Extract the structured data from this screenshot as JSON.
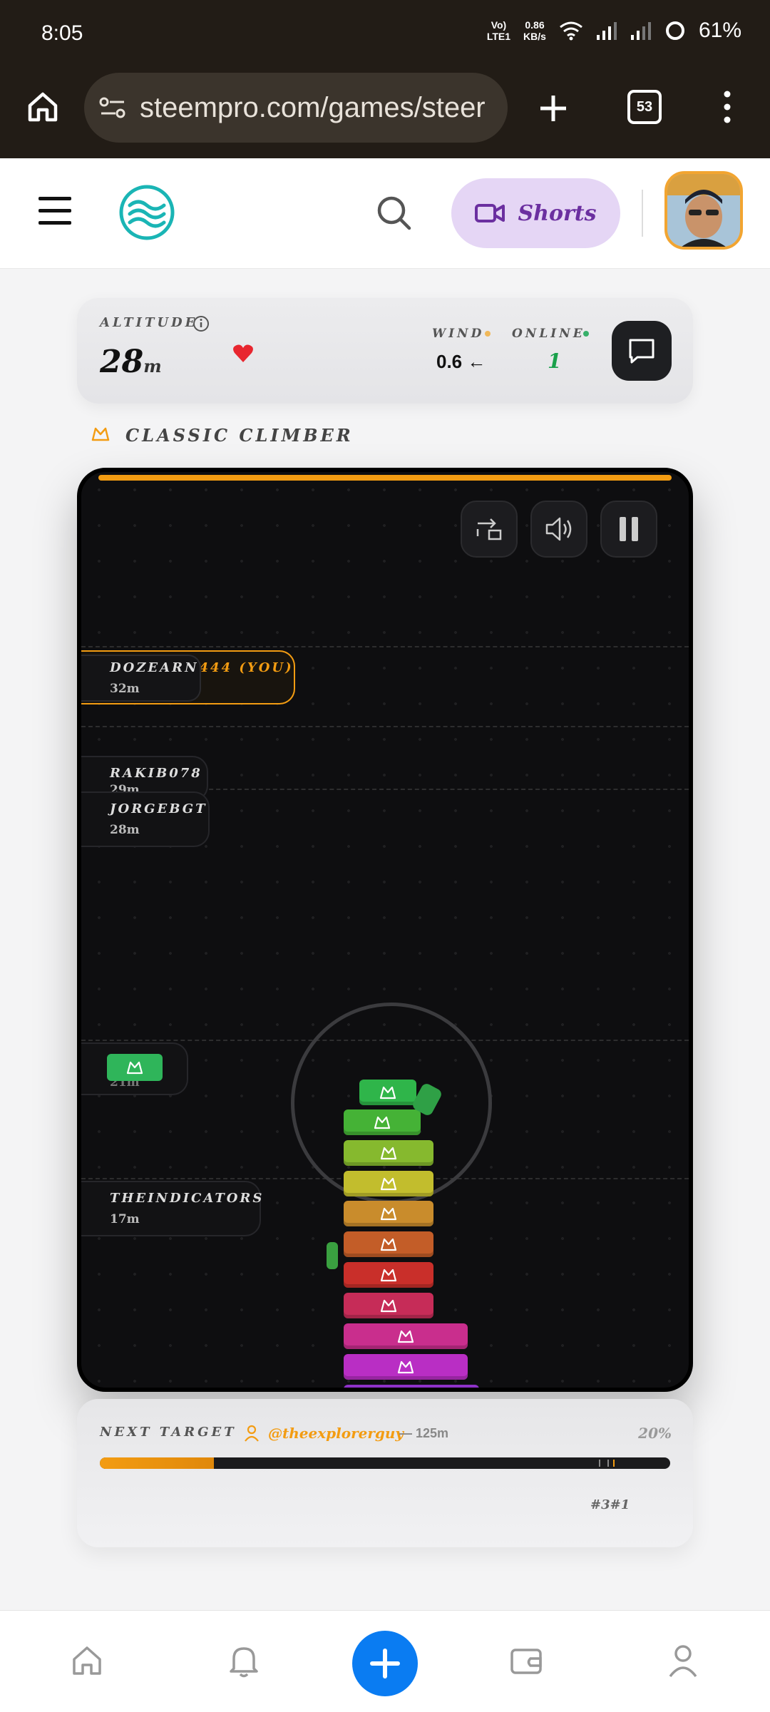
{
  "status": {
    "time": "8:05",
    "network_top": "Vo)",
    "network_bottom": "LTE1",
    "speed_top": "0.86",
    "speed_bottom": "KB/s",
    "battery": "61%"
  },
  "browser": {
    "url": "steempro.com/games/steer",
    "tab_count": "53"
  },
  "header": {
    "shorts_label": "Shorts"
  },
  "stats": {
    "altitude_label": "ALTITUDE",
    "altitude_value": "28",
    "altitude_unit": "m",
    "wind_label": "WIND",
    "wind_value": "0.6 ←",
    "online_label": "ONLINE",
    "online_value": "1"
  },
  "mode": {
    "label": "CLASSIC CLIMBER"
  },
  "game": {
    "players": [
      {
        "name": "DOZEARN",
        "name_hidden_part": "1444 (YOU)",
        "height": "32m"
      },
      {
        "name": "RAKIB078",
        "height": "29m"
      },
      {
        "name": "JORGEBGT",
        "height": "28m"
      },
      {
        "name": "",
        "height": "21m"
      },
      {
        "name": "THEINDICATORS",
        "height": "17m"
      }
    ]
  },
  "next_target": {
    "label": "NEXT TARGET",
    "user": "@theexplorerguy",
    "distance": "— 125m",
    "percent": "20%",
    "progress": 0.2,
    "rank": "#3#1"
  },
  "colors": {
    "accent_orange": "#f39c12",
    "online_green": "#1aa14b",
    "heart_red": "#e8262f",
    "brand_blue": "#0a7cf2"
  }
}
